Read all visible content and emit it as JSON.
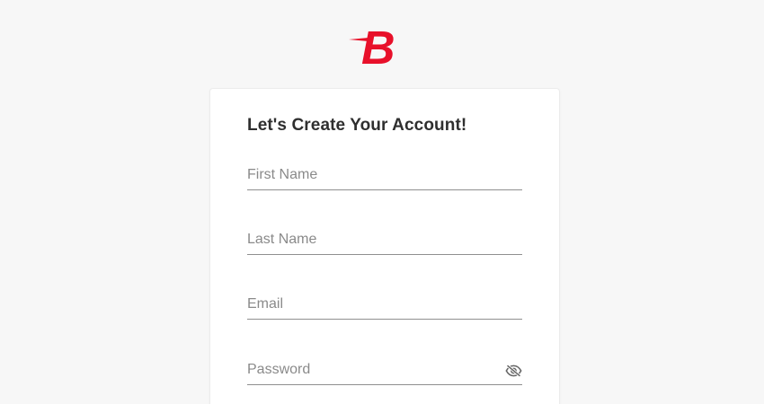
{
  "brand": {
    "logo_letter": "B",
    "color": "#e8102a"
  },
  "form": {
    "title": "Let's Create Your Account!",
    "first_name_placeholder": "First Name",
    "last_name_placeholder": "Last Name",
    "email_placeholder": "Email",
    "password_placeholder": "Password",
    "password_toggle_icon": "eye-slash-icon"
  }
}
